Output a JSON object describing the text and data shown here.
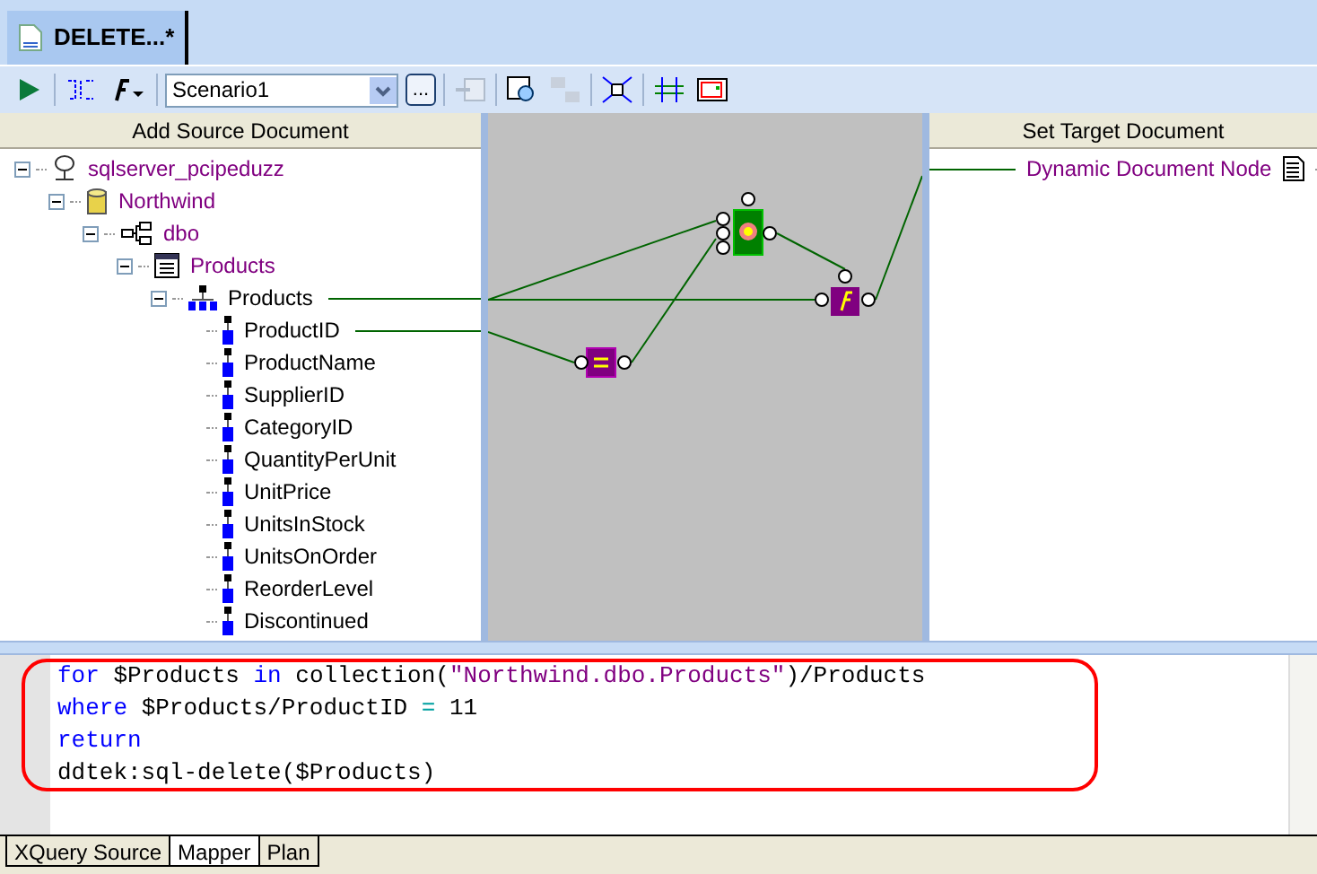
{
  "document_tab": {
    "title": "DELETE...*",
    "selected": true
  },
  "toolbar": {
    "scenario": {
      "value": "Scenario1"
    },
    "browse_button": "..."
  },
  "source_panel": {
    "header": "Add Source Document",
    "tree": [
      {
        "label": "sqlserver_pcipeduzz",
        "kind": "server",
        "expanded": true,
        "children": [
          {
            "label": "Northwind",
            "kind": "database",
            "expanded": true,
            "children": [
              {
                "label": "dbo",
                "kind": "schema",
                "expanded": true,
                "children": [
                  {
                    "label": "Products",
                    "kind": "table",
                    "expanded": true,
                    "children": [
                      {
                        "label": "Products",
                        "kind": "element",
                        "expanded": true,
                        "mapped": true,
                        "children": [
                          {
                            "label": "ProductID",
                            "kind": "field",
                            "mapped": true
                          },
                          {
                            "label": "ProductName",
                            "kind": "field",
                            "mapped": false
                          },
                          {
                            "label": "SupplierID",
                            "kind": "field",
                            "mapped": false
                          },
                          {
                            "label": "CategoryID",
                            "kind": "field",
                            "mapped": false
                          },
                          {
                            "label": "QuantityPerUnit",
                            "kind": "field",
                            "mapped": false
                          },
                          {
                            "label": "UnitPrice",
                            "kind": "field",
                            "mapped": false
                          },
                          {
                            "label": "UnitsInStock",
                            "kind": "field",
                            "mapped": false
                          },
                          {
                            "label": "UnitsOnOrder",
                            "kind": "field",
                            "mapped": false
                          },
                          {
                            "label": "ReorderLevel",
                            "kind": "field",
                            "mapped": false
                          },
                          {
                            "label": "Discontinued",
                            "kind": "field",
                            "mapped": false
                          }
                        ]
                      }
                    ]
                  }
                ]
              }
            ]
          }
        ]
      }
    ]
  },
  "target_panel": {
    "header": "Set Target Document",
    "nodes": [
      {
        "label": "Dynamic Document Node",
        "mapped": true
      }
    ]
  },
  "code": {
    "lines": [
      [
        {
          "kind": "keyword",
          "text": "for"
        },
        {
          "kind": "plain",
          "text": " $Products "
        },
        {
          "kind": "keyword",
          "text": "in"
        },
        {
          "kind": "plain",
          "text": " collection("
        },
        {
          "kind": "string",
          "text": "\"Northwind.dbo.Products\""
        },
        {
          "kind": "plain",
          "text": ")/Products"
        }
      ],
      [
        {
          "kind": "keyword",
          "text": "where"
        },
        {
          "kind": "plain",
          "text": " $Products/ProductID "
        },
        {
          "kind": "operator",
          "text": "="
        },
        {
          "kind": "plain",
          "text": " 11"
        }
      ],
      [
        {
          "kind": "keyword",
          "text": "return"
        }
      ],
      [
        {
          "kind": "plain",
          "text": "ddtek:sql-delete($Products)"
        }
      ]
    ]
  },
  "bottom_tabs": [
    {
      "label": "XQuery Source",
      "selected": false
    },
    {
      "label": "Mapper",
      "selected": true
    },
    {
      "label": "Plan",
      "selected": false
    }
  ]
}
